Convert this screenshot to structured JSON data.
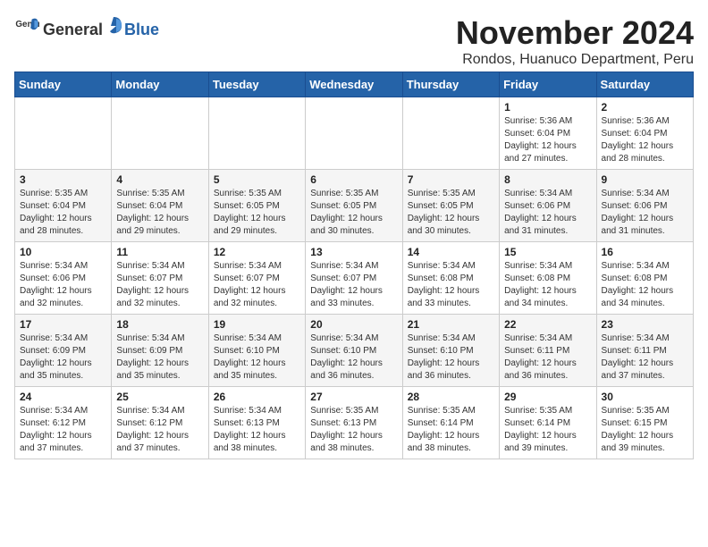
{
  "header": {
    "logo_general": "General",
    "logo_blue": "Blue",
    "month_title": "November 2024",
    "location": "Rondos, Huanuco Department, Peru"
  },
  "days_of_week": [
    "Sunday",
    "Monday",
    "Tuesday",
    "Wednesday",
    "Thursday",
    "Friday",
    "Saturday"
  ],
  "weeks": [
    [
      {
        "day": "",
        "info": ""
      },
      {
        "day": "",
        "info": ""
      },
      {
        "day": "",
        "info": ""
      },
      {
        "day": "",
        "info": ""
      },
      {
        "day": "",
        "info": ""
      },
      {
        "day": "1",
        "info": "Sunrise: 5:36 AM\nSunset: 6:04 PM\nDaylight: 12 hours and 27 minutes."
      },
      {
        "day": "2",
        "info": "Sunrise: 5:36 AM\nSunset: 6:04 PM\nDaylight: 12 hours and 28 minutes."
      }
    ],
    [
      {
        "day": "3",
        "info": "Sunrise: 5:35 AM\nSunset: 6:04 PM\nDaylight: 12 hours and 28 minutes."
      },
      {
        "day": "4",
        "info": "Sunrise: 5:35 AM\nSunset: 6:04 PM\nDaylight: 12 hours and 29 minutes."
      },
      {
        "day": "5",
        "info": "Sunrise: 5:35 AM\nSunset: 6:05 PM\nDaylight: 12 hours and 29 minutes."
      },
      {
        "day": "6",
        "info": "Sunrise: 5:35 AM\nSunset: 6:05 PM\nDaylight: 12 hours and 30 minutes."
      },
      {
        "day": "7",
        "info": "Sunrise: 5:35 AM\nSunset: 6:05 PM\nDaylight: 12 hours and 30 minutes."
      },
      {
        "day": "8",
        "info": "Sunrise: 5:34 AM\nSunset: 6:06 PM\nDaylight: 12 hours and 31 minutes."
      },
      {
        "day": "9",
        "info": "Sunrise: 5:34 AM\nSunset: 6:06 PM\nDaylight: 12 hours and 31 minutes."
      }
    ],
    [
      {
        "day": "10",
        "info": "Sunrise: 5:34 AM\nSunset: 6:06 PM\nDaylight: 12 hours and 32 minutes."
      },
      {
        "day": "11",
        "info": "Sunrise: 5:34 AM\nSunset: 6:07 PM\nDaylight: 12 hours and 32 minutes."
      },
      {
        "day": "12",
        "info": "Sunrise: 5:34 AM\nSunset: 6:07 PM\nDaylight: 12 hours and 32 minutes."
      },
      {
        "day": "13",
        "info": "Sunrise: 5:34 AM\nSunset: 6:07 PM\nDaylight: 12 hours and 33 minutes."
      },
      {
        "day": "14",
        "info": "Sunrise: 5:34 AM\nSunset: 6:08 PM\nDaylight: 12 hours and 33 minutes."
      },
      {
        "day": "15",
        "info": "Sunrise: 5:34 AM\nSunset: 6:08 PM\nDaylight: 12 hours and 34 minutes."
      },
      {
        "day": "16",
        "info": "Sunrise: 5:34 AM\nSunset: 6:08 PM\nDaylight: 12 hours and 34 minutes."
      }
    ],
    [
      {
        "day": "17",
        "info": "Sunrise: 5:34 AM\nSunset: 6:09 PM\nDaylight: 12 hours and 35 minutes."
      },
      {
        "day": "18",
        "info": "Sunrise: 5:34 AM\nSunset: 6:09 PM\nDaylight: 12 hours and 35 minutes."
      },
      {
        "day": "19",
        "info": "Sunrise: 5:34 AM\nSunset: 6:10 PM\nDaylight: 12 hours and 35 minutes."
      },
      {
        "day": "20",
        "info": "Sunrise: 5:34 AM\nSunset: 6:10 PM\nDaylight: 12 hours and 36 minutes."
      },
      {
        "day": "21",
        "info": "Sunrise: 5:34 AM\nSunset: 6:10 PM\nDaylight: 12 hours and 36 minutes."
      },
      {
        "day": "22",
        "info": "Sunrise: 5:34 AM\nSunset: 6:11 PM\nDaylight: 12 hours and 36 minutes."
      },
      {
        "day": "23",
        "info": "Sunrise: 5:34 AM\nSunset: 6:11 PM\nDaylight: 12 hours and 37 minutes."
      }
    ],
    [
      {
        "day": "24",
        "info": "Sunrise: 5:34 AM\nSunset: 6:12 PM\nDaylight: 12 hours and 37 minutes."
      },
      {
        "day": "25",
        "info": "Sunrise: 5:34 AM\nSunset: 6:12 PM\nDaylight: 12 hours and 37 minutes."
      },
      {
        "day": "26",
        "info": "Sunrise: 5:34 AM\nSunset: 6:13 PM\nDaylight: 12 hours and 38 minutes."
      },
      {
        "day": "27",
        "info": "Sunrise: 5:35 AM\nSunset: 6:13 PM\nDaylight: 12 hours and 38 minutes."
      },
      {
        "day": "28",
        "info": "Sunrise: 5:35 AM\nSunset: 6:14 PM\nDaylight: 12 hours and 38 minutes."
      },
      {
        "day": "29",
        "info": "Sunrise: 5:35 AM\nSunset: 6:14 PM\nDaylight: 12 hours and 39 minutes."
      },
      {
        "day": "30",
        "info": "Sunrise: 5:35 AM\nSunset: 6:15 PM\nDaylight: 12 hours and 39 minutes."
      }
    ]
  ]
}
